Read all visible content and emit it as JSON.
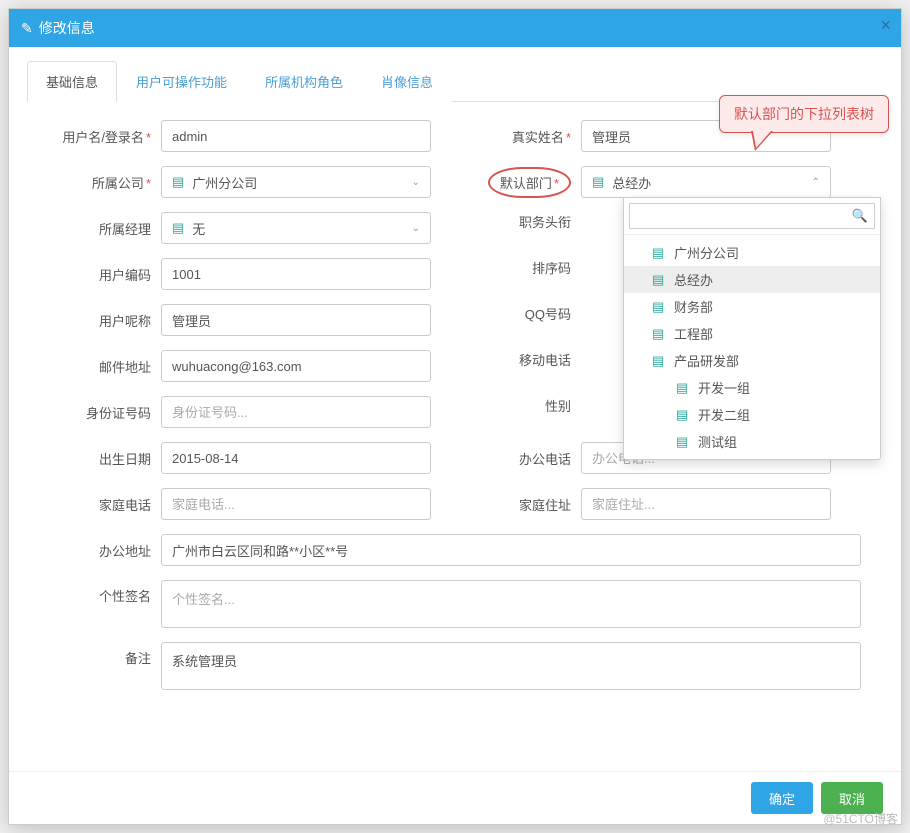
{
  "header": {
    "title": "修改信息"
  },
  "tabs": [
    {
      "label": "基础信息",
      "active": true
    },
    {
      "label": "用户可操作功能",
      "active": false
    },
    {
      "label": "所属机构角色",
      "active": false
    },
    {
      "label": "肖像信息",
      "active": false
    }
  ],
  "form": {
    "username_label": "用户名/登录名",
    "username_value": "admin",
    "realname_label": "真实姓名",
    "realname_value": "管理员",
    "company_label": "所属公司",
    "company_value": "广州分公司",
    "dept_label": "默认部门",
    "dept_value": "总经办",
    "manager_label": "所属经理",
    "manager_value": "无",
    "jobtitle_label": "职务头衔",
    "usercode_label": "用户编码",
    "usercode_value": "1001",
    "sortcode_label": "排序码",
    "nickname_label": "用户呢称",
    "nickname_value": "管理员",
    "qq_label": "QQ号码",
    "email_label": "邮件地址",
    "email_value": "wuhuacong@163.com",
    "mobile_label": "移动电话",
    "idcard_label": "身份证号码",
    "idcard_placeholder": "身份证号码...",
    "gender_label": "性别",
    "birthdate_label": "出生日期",
    "birthdate_value": "2015-08-14",
    "officephone_label": "办公电话",
    "officephone_placeholder": "办公电话...",
    "homephone_label": "家庭电话",
    "homephone_placeholder": "家庭电话...",
    "homeaddr_label": "家庭住址",
    "homeaddr_placeholder": "家庭住址...",
    "officeaddr_label": "办公地址",
    "officeaddr_value": "广州市白云区同和路**小区**号",
    "signature_label": "个性签名",
    "signature_placeholder": "个性签名...",
    "remark_label": "备注",
    "remark_value": "系统管理员"
  },
  "dropdown": {
    "search_placeholder": "",
    "items": [
      {
        "label": "广州分公司",
        "indent": 1,
        "selected": false
      },
      {
        "label": "总经办",
        "indent": 1,
        "selected": true
      },
      {
        "label": "财务部",
        "indent": 1,
        "selected": false
      },
      {
        "label": "工程部",
        "indent": 1,
        "selected": false
      },
      {
        "label": "产品研发部",
        "indent": 1,
        "selected": false
      },
      {
        "label": "开发一组",
        "indent": 2,
        "selected": false
      },
      {
        "label": "开发二组",
        "indent": 2,
        "selected": false
      },
      {
        "label": "测试组",
        "indent": 2,
        "selected": false
      }
    ]
  },
  "callout": {
    "text": "默认部门的下拉列表树"
  },
  "footer": {
    "ok_label": "确定",
    "cancel_label": "取消"
  },
  "watermark": "@51CTO博客"
}
